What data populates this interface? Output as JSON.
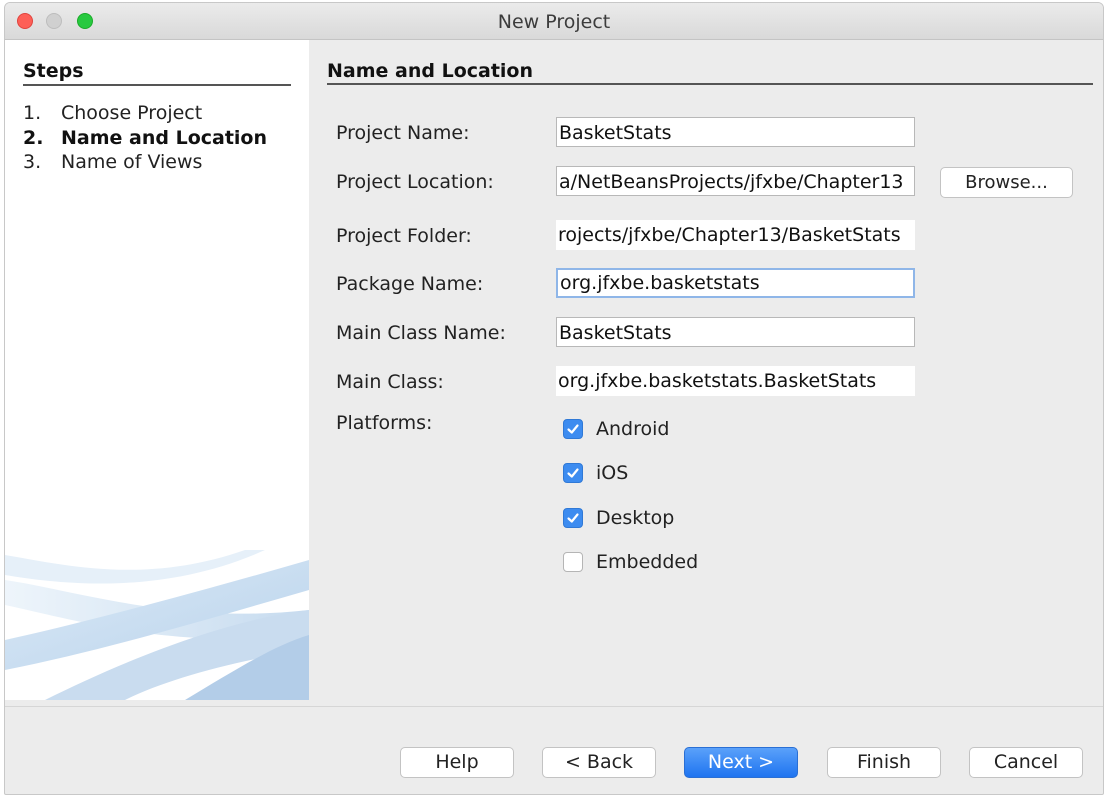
{
  "window": {
    "title": "New Project"
  },
  "steps": {
    "heading": "Steps",
    "items": [
      {
        "number": "1.",
        "label": "Choose Project"
      },
      {
        "number": "2.",
        "label": "Name and Location"
      },
      {
        "number": "3.",
        "label": "Name of Views"
      }
    ],
    "current": 2
  },
  "panel": {
    "title": "Name and Location",
    "fields": {
      "project_name": {
        "label": "Project Name:",
        "value": "BasketStats"
      },
      "project_location": {
        "label": "Project Location:",
        "value": "a/NetBeansProjects/jfxbe/Chapter13"
      },
      "project_folder": {
        "label": "Project Folder:",
        "value": "rojects/jfxbe/Chapter13/BasketStats"
      },
      "package_name": {
        "label": "Package Name:",
        "value": "org.jfxbe.basketstats"
      },
      "main_class_name": {
        "label": "Main Class Name:",
        "value": "BasketStats"
      },
      "main_class": {
        "label": "Main Class:",
        "value": "org.jfxbe.basketstats.BasketStats"
      }
    },
    "browse_label": "Browse...",
    "platforms": {
      "label": "Platforms:",
      "options": [
        {
          "label": "Android",
          "checked": true
        },
        {
          "label": "iOS",
          "checked": true
        },
        {
          "label": "Desktop",
          "checked": true
        },
        {
          "label": "Embedded",
          "checked": false
        }
      ]
    }
  },
  "buttons": {
    "help": "Help",
    "back": "< Back",
    "next": "Next >",
    "finish": "Finish",
    "cancel": "Cancel"
  },
  "colors": {
    "accent": "#3d8cf0",
    "focus_ring": "#8fb6e8",
    "close": "#fd5f57",
    "maximize": "#27c93f"
  }
}
